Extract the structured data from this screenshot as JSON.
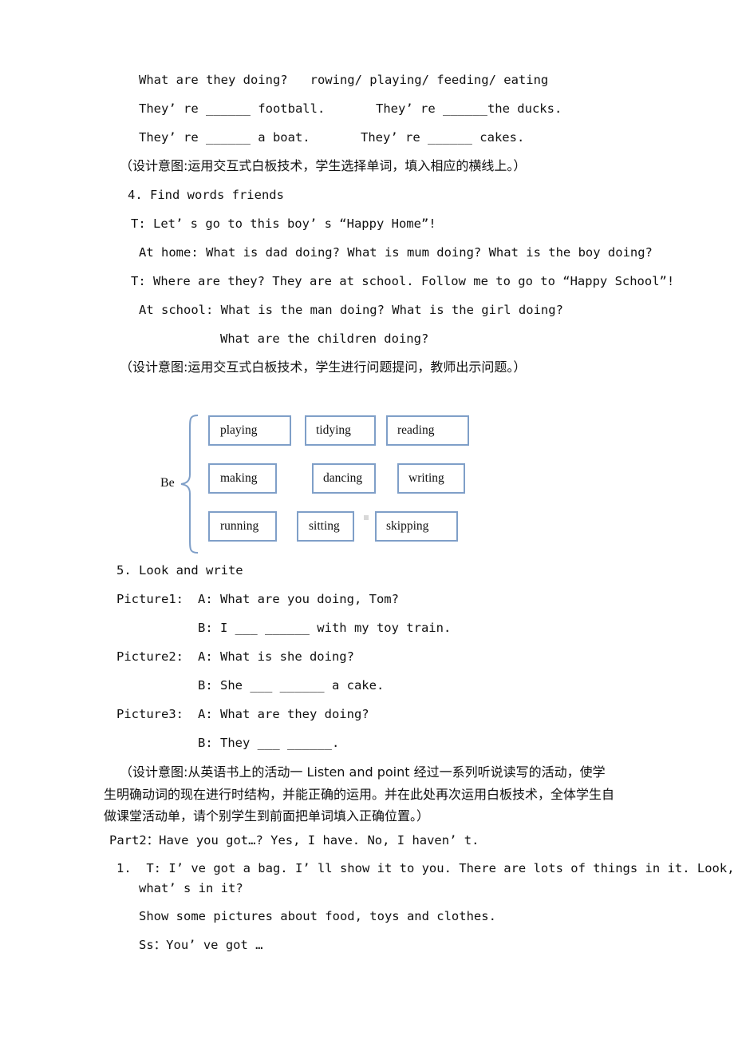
{
  "exercise3": {
    "question": "What are they doing?   rowing/ playing/ feeding/ eating",
    "row1_left": "They’ re ______ football.",
    "row1_right": "They’ re ______the ducks.",
    "row2_left": "They’ re ______ a boat.",
    "row2_right": "They’ re ______ cakes.",
    "design_note": "（设计意图:运用交互式白板技术，学生选择单词，填入相应的横线上。）"
  },
  "exercise4": {
    "heading": "4. Find words friends",
    "lines": [
      "T: Let’ s go to this boy’ s “Happy Home”!",
      "At home: What is dad doing? What is mum doing? What is the boy doing?",
      "T: Where are they? They are at school. Follow me to go to “Happy School”!",
      "At school: What is the man doing? What is the girl doing?",
      "What are the children doing?"
    ],
    "design_note": "（设计意图:运用交互式白板技术，学生进行问题提问，教师出示问题。）"
  },
  "diagram": {
    "root": "Be",
    "words": [
      "playing",
      "tidying",
      "reading",
      "making",
      "dancing",
      "writing",
      "running",
      "sitting",
      "skipping"
    ],
    "box_border_color": "#7f9fc8"
  },
  "exercise5": {
    "heading": "5. Look and write",
    "pictures": [
      {
        "label": "Picture1:",
        "a": "A: What are you doing, Tom?",
        "b": "B: I ___ ______ with my toy train."
      },
      {
        "label": "Picture2:",
        "a": "A: What is she doing?",
        "b": "B: She ___ ______ a cake."
      },
      {
        "label": "Picture3:",
        "a": "A: What are they doing?",
        "b": "B: They ___ ______."
      }
    ],
    "design_note_lines": [
      "（设计意图:从英语书上的活动一 Listen and point 经过一系列听说读写的活动，使学",
      "生明确动词的现在进行时结构，并能正确的运用。并在此处再次运用白板技术，全体学生自",
      "做课堂活动单，请个别学生到前面把单词填入正确位置。）"
    ]
  },
  "part2": {
    "heading": "Part2：Have you got…? Yes, I have. No, I haven’ t.",
    "item1_line1": "1.  T: I’ ve got a bag. I’ ll show it to you. There are lots of things in it. Look,",
    "item1_line2": "what’ s in it?",
    "item1_line3": "Show some pictures about food, toys and clothes.",
    "item1_line4": "Ss：You’ ve got …"
  }
}
